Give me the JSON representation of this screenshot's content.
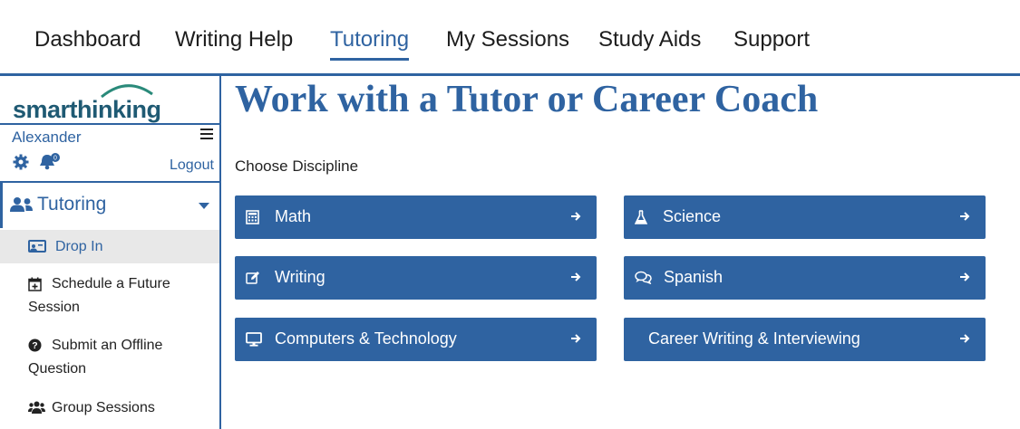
{
  "topnav": {
    "tabs": [
      {
        "label": "Dashboard"
      },
      {
        "label": "Writing Help"
      },
      {
        "label": "Tutoring"
      },
      {
        "label": "My Sessions"
      },
      {
        "label": "Study Aids"
      },
      {
        "label": "Support"
      }
    ],
    "active_tab": "Tutoring"
  },
  "sidebar": {
    "logo_text": "smarthinking",
    "username": "Alexander",
    "notification_count": "0",
    "logout_label": "Logout",
    "section": {
      "label": "Tutoring",
      "expanded": true
    },
    "items": [
      {
        "label": "Drop In",
        "icon": "drop-in-icon",
        "active": true
      },
      {
        "label": "Schedule a Future Session",
        "icon": "calendar-plus-icon"
      },
      {
        "label": "Submit an Offline Question",
        "icon": "question-circle-icon"
      },
      {
        "label": "Group Sessions",
        "icon": "group-icon"
      }
    ]
  },
  "main": {
    "title": "Work with a Tutor or Career Coach",
    "choose_label": "Choose Discipline",
    "disciplines": [
      {
        "label": "Math",
        "icon": "calculator-icon"
      },
      {
        "label": "Science",
        "icon": "flask-icon"
      },
      {
        "label": "Writing",
        "icon": "edit-icon"
      },
      {
        "label": "Spanish",
        "icon": "chat-bubbles-icon"
      },
      {
        "label": "Computers & Technology",
        "icon": "monitor-icon"
      },
      {
        "label": "Career Writing & Interviewing",
        "icon": ""
      }
    ]
  },
  "colors": {
    "brand_blue": "#2f63a1",
    "logo_teal": "#1f5a73",
    "active_item_bg": "#e8e8e8"
  }
}
